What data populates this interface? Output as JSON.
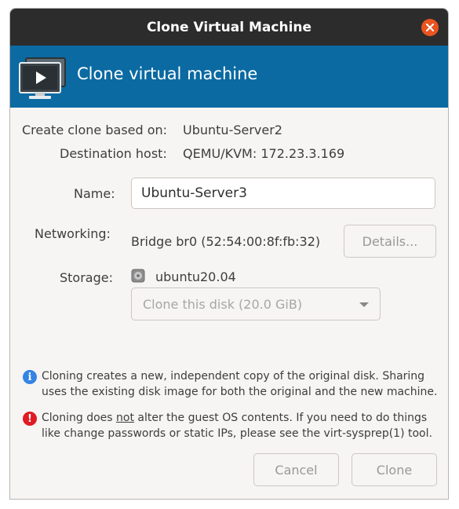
{
  "window": {
    "title": "Clone Virtual Machine",
    "banner_title": "Clone virtual machine"
  },
  "source": {
    "based_on_label": "Create clone based on:",
    "based_on_value": "Ubuntu-Server2",
    "dest_label": "Destination host:",
    "dest_value": "QEMU/KVM: 172.23.3.169"
  },
  "form": {
    "name_label": "Name:",
    "name_value": "Ubuntu-Server3",
    "networking_label": "Networking:",
    "networking_value": "Bridge br0 (52:54:00:8f:fb:32)",
    "details_button": "Details...",
    "storage_label": "Storage:",
    "storage_disk": "ubuntu20.04",
    "storage_option": "Clone this disk (20.0 GiB)"
  },
  "notes": {
    "info_part1": "Cloning creates a new, independent copy of the original disk. Sharing",
    "info_part2": "uses the existing disk image for both the original and the new machine.",
    "warn_before": "Cloning does ",
    "warn_underlined": "not",
    "warn_after": " alter the guest OS contents. If you need to do things",
    "warn_line2": "like change passwords or static IPs, please see the virt-sysprep(1) tool."
  },
  "actions": {
    "cancel": "Cancel",
    "clone": "Clone"
  },
  "colors": {
    "banner": "#0b6aa2",
    "titlebar": "#2c2c2c",
    "close": "#e95420",
    "info": "#3584e4",
    "warning": "#e01b24"
  }
}
